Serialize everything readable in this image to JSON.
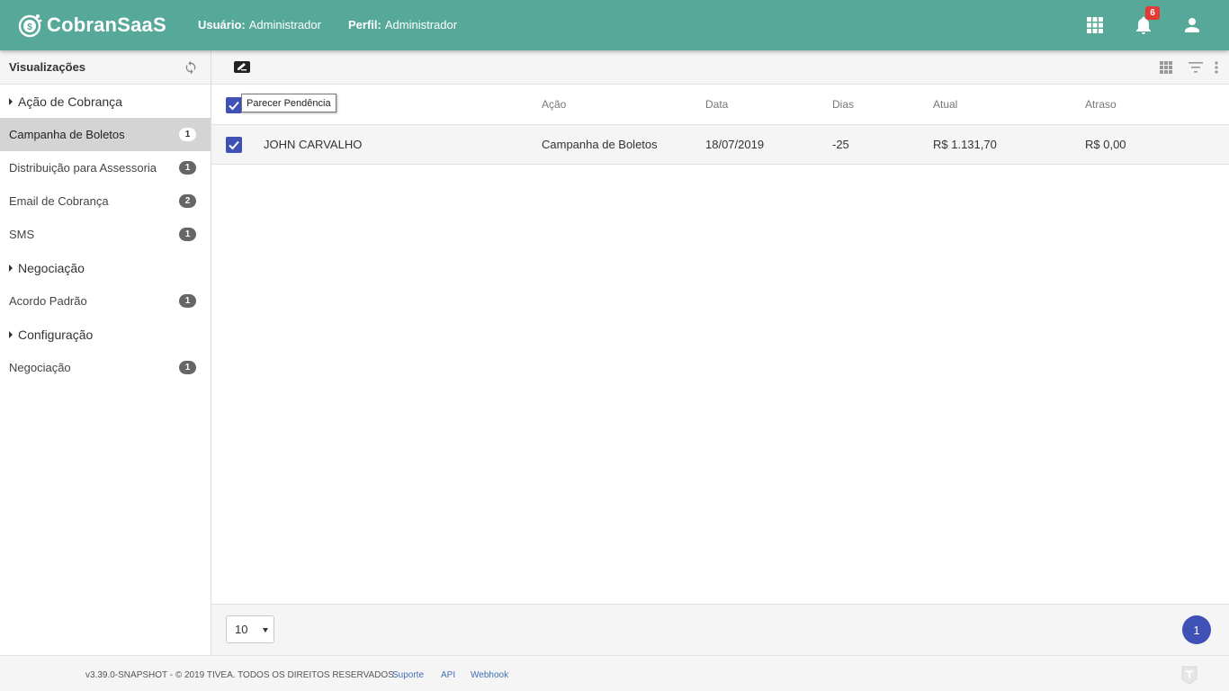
{
  "app": {
    "brand": "CobranSaaS",
    "user_label": "Usuário:",
    "user_value": "Administrador",
    "profile_label": "Perfil:",
    "profile_value": "Administrador",
    "notifications_count": "6",
    "accent_color": "#56a899",
    "primary_color": "#3f51b5"
  },
  "sidebar": {
    "title": "Visualizações",
    "groups": [
      {
        "title": "Ação de Cobrança",
        "items": [
          {
            "label": "Campanha de Boletos",
            "count": "1",
            "active": true
          },
          {
            "label": "Distribuição para Assessoria",
            "count": "1"
          },
          {
            "label": "Email de Cobrança",
            "count": "2"
          },
          {
            "label": "SMS",
            "count": "1"
          }
        ]
      },
      {
        "title": "Negociação",
        "items": [
          {
            "label": "Acordo Padrão",
            "count": "1"
          }
        ]
      },
      {
        "title": "Configuração",
        "items": [
          {
            "label": "Negociação",
            "count": "1"
          }
        ]
      }
    ]
  },
  "table": {
    "tooltip": "Parecer Pendência",
    "columns": [
      "",
      "Ação",
      "Data",
      "Dias",
      "Atual",
      "Atraso"
    ],
    "rows": [
      {
        "name": "JOHN CARVALHO",
        "acao": "Campanha de Boletos",
        "data": "18/07/2019",
        "dias": "-25",
        "atual": "R$ 1.131,70",
        "atraso": "R$ 0,00",
        "checked": true
      }
    ]
  },
  "pager": {
    "page_size": "10",
    "current_page": "1"
  },
  "footer": {
    "copyright": "v3.39.0-SNAPSHOT - © 2019 TIVEA. TODOS OS DIREITOS RESERVADOS.",
    "links": [
      "Suporte",
      "API",
      "Webhook"
    ]
  }
}
